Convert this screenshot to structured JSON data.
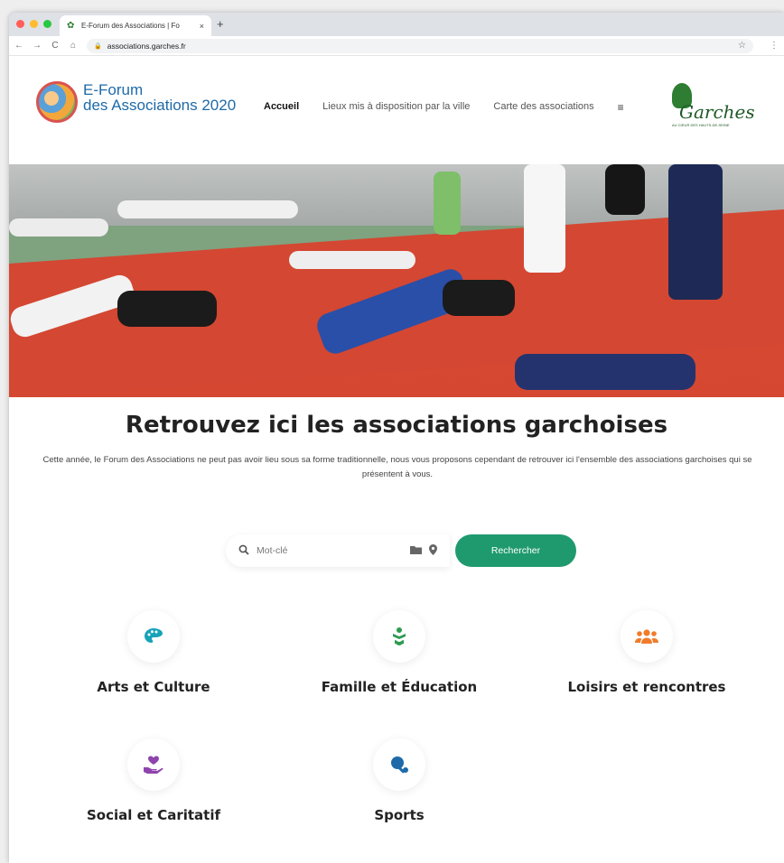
{
  "browser": {
    "tab_title": "E-Forum des Associations | Fo",
    "tab_close": "×",
    "new_tab": "+",
    "url": "associations.garches.fr",
    "back": "←",
    "forward": "→",
    "reload": "C",
    "home": "⌂",
    "lock": "🔒",
    "star": "☆",
    "menu": "⋮"
  },
  "header": {
    "logo_line1": "E-Forum",
    "logo_line2": "des Associations 2020",
    "nav": [
      "Accueil",
      "Lieux mis à disposition par la ville",
      "Carte des associations"
    ],
    "menu_icon": "≡",
    "partner_logo": "Garches",
    "partner_tagline": "AU CŒUR DES HAUTS-DE-SEINE"
  },
  "main": {
    "headline": "Retrouvez ici les associations garchoises",
    "intro": "Cette année, le Forum des Associations ne peut pas avoir lieu sous sa forme traditionnelle, nous vous proposons cependant de retrouver ici l'ensemble des associations garchoises qui se présentent à vous.",
    "search": {
      "placeholder": "Mot-clé",
      "search_icon": "search-icon",
      "category_icon": "folder-icon",
      "location_icon": "map-pin-icon",
      "button": "Rechercher"
    },
    "categories": [
      {
        "label": "Arts et Culture",
        "icon": "palette-icon",
        "glyph": "🎨",
        "color": "#17a2b8"
      },
      {
        "label": "Famille et Éducation",
        "icon": "family-icon",
        "glyph": "✿",
        "color": "#2e9b4f"
      },
      {
        "label": "Loisirs et rencontres",
        "icon": "group-icon",
        "glyph": "👥",
        "color": "#f07b2a"
      },
      {
        "label": "Social et Caritatif",
        "icon": "heart-hand-icon",
        "glyph": "♥",
        "color": "#8e44ad"
      },
      {
        "label": "Sports",
        "icon": "ping-pong-icon",
        "glyph": "🏓",
        "color": "#1e6aa8"
      }
    ]
  },
  "colors": {
    "accent": "#1f9a6f",
    "logo_blue": "#1e6aa8"
  }
}
